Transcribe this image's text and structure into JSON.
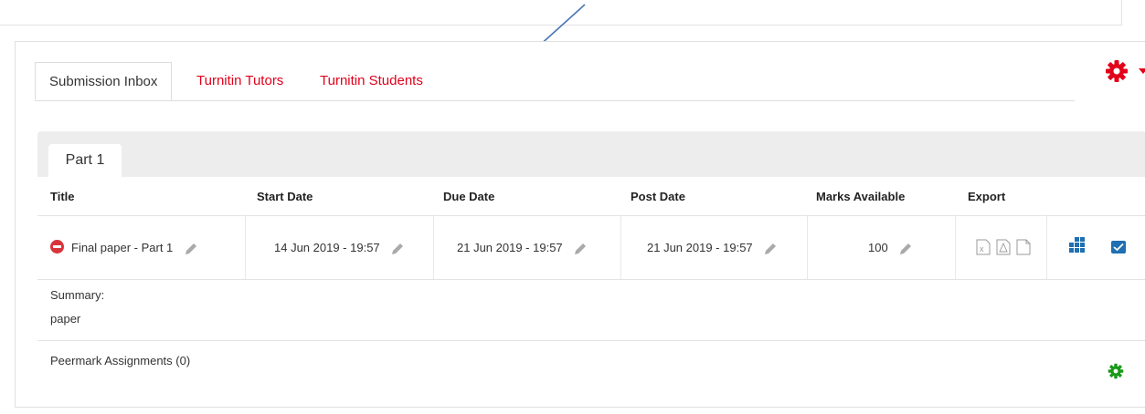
{
  "tabs": [
    {
      "label": "Submission Inbox",
      "active": true
    },
    {
      "label": "Turnitin Tutors",
      "active": false
    },
    {
      "label": "Turnitin Students",
      "active": false
    }
  ],
  "part": {
    "label": "Part 1"
  },
  "table": {
    "headers": [
      "Title",
      "Start Date",
      "Due Date",
      "Post Date",
      "Marks Available",
      "Export"
    ],
    "row": {
      "title": "Final paper - Part 1",
      "start_date": "14 Jun 2019 - 19:57",
      "due_date": "21 Jun 2019 - 19:57",
      "post_date": "21 Jun 2019 - 19:57",
      "marks": "100"
    }
  },
  "summary": {
    "label": "Summary:",
    "text": "paper"
  },
  "peermark": {
    "label": "Peermark Assignments (0)"
  },
  "colors": {
    "accent_red": "#e2001a",
    "blue": "#1f6fb2",
    "green": "#1a9a1a"
  }
}
